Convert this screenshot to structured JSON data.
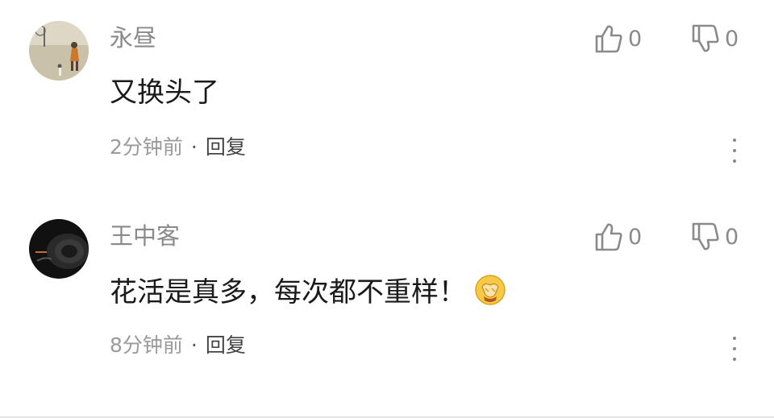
{
  "comments": [
    {
      "username": "永昼",
      "text": "又换头了",
      "time": "2分钟前",
      "separator": "·",
      "reply": "回复",
      "likes": "0",
      "dislikes": "0",
      "avatar_icon": "basketball-photo-avatar"
    },
    {
      "username": "王中客",
      "text": "花活是真多，每次都不重样！",
      "emoji_icon": "clapping-hands-emoji",
      "time": "8分钟前",
      "separator": "·",
      "reply": "回复",
      "likes": "0",
      "dislikes": "0",
      "avatar_icon": "dark-photo-avatar"
    }
  ],
  "icons": {
    "like": "thumbs-up-icon",
    "dislike": "thumbs-down-icon",
    "more": "more-vertical-icon"
  },
  "colors": {
    "username": "#8a8a8a",
    "text": "#1a1a1a",
    "meta": "#9a9a9a",
    "reply": "#444444"
  }
}
